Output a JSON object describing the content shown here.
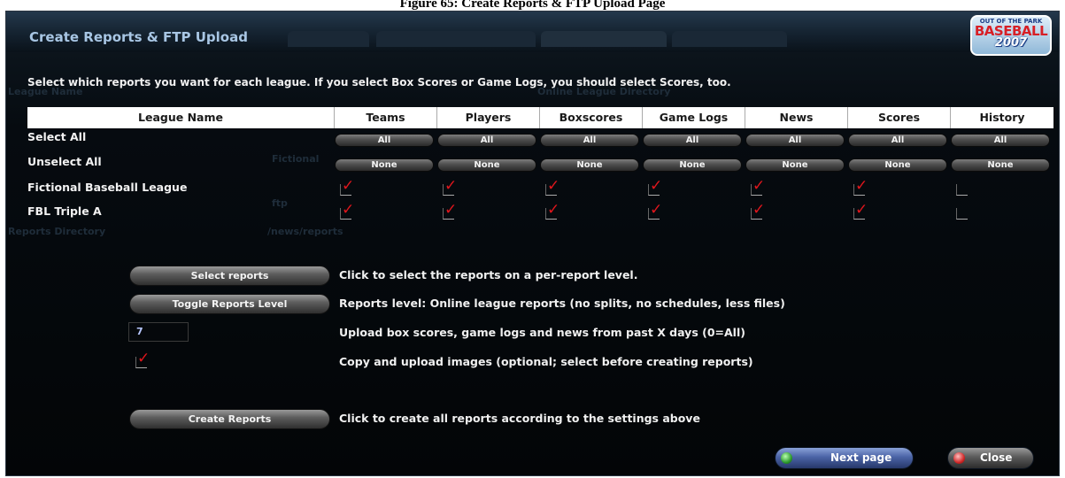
{
  "caption": "Figure 65: Create Reports & FTP Upload Page",
  "window": {
    "title": "Create Reports & FTP Upload",
    "logo": {
      "line1": "OUT OF THE PARK",
      "line2": "BASEBALL",
      "line3": "2007"
    }
  },
  "instruction": "Select which reports you want for each league. If you select Box Scores or Game Logs, you should select Scores, too.",
  "table": {
    "columns": [
      "League Name",
      "Teams",
      "Players",
      "Boxscores",
      "Game Logs",
      "News",
      "Scores",
      "History"
    ],
    "select_all_label": "Select All",
    "unselect_all_label": "Unselect All",
    "all_button": "All",
    "none_button": "None",
    "leagues": [
      {
        "name": "Fictional Baseball League",
        "checks": [
          true,
          true,
          true,
          true,
          true,
          true,
          false
        ]
      },
      {
        "name": "FBL Triple A",
        "checks": [
          true,
          true,
          true,
          true,
          true,
          true,
          false
        ]
      }
    ]
  },
  "options": {
    "select_reports_button": "Select reports",
    "select_reports_desc": "Click to select the reports on a per-report level.",
    "toggle_level_button": "Toggle Reports Level",
    "toggle_level_desc": "Reports level: Online league reports (no splits, no schedules, less files)",
    "days_value": "7",
    "days_desc": "Upload box scores, game logs and news from past X days (0=All)",
    "copy_images_checked": true,
    "copy_images_desc": "Copy and upload images (optional; select before creating reports)",
    "create_reports_button": "Create Reports",
    "create_reports_desc": "Click to create all reports according to the settings above"
  },
  "footer": {
    "next_button": "Next page",
    "close_button": "Close"
  },
  "colors": {
    "check_mark": "#e0161c",
    "title": "#a8c6e4",
    "next_button": "#4a63a6"
  }
}
